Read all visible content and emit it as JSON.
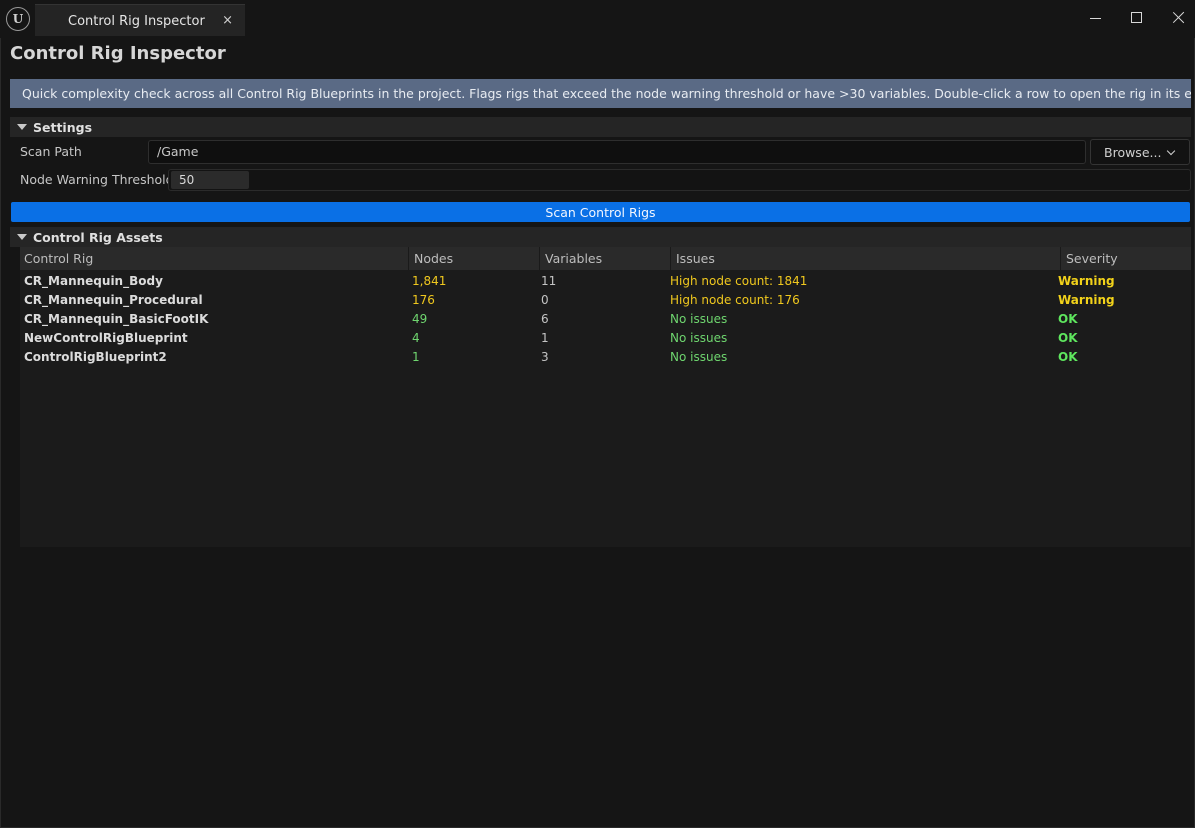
{
  "window": {
    "tab_title": "Control Rig Inspector",
    "tab_close_glyph": "×",
    "logo_text": "U"
  },
  "page": {
    "title": "Control Rig Inspector",
    "info": "Quick complexity check across all Control Rig Blueprints in the project. Flags rigs that exceed the node warning threshold or have >30 variables. Double-click a row to open the rig in its editor."
  },
  "settings": {
    "section_label": "Settings",
    "scan_path_label": "Scan Path",
    "scan_path_value": "/Game",
    "browse_label": "Browse...",
    "threshold_label": "Node Warning Threshold",
    "threshold_value": "50",
    "scan_button_label": "Scan Control Rigs"
  },
  "assets": {
    "section_label": "Control Rig Assets",
    "columns": [
      "Control Rig",
      "Nodes",
      "Variables",
      "Issues",
      "Severity"
    ],
    "rows": [
      {
        "name": "CR_Mannequin_Body",
        "nodes": "1,841",
        "variables": "11",
        "issues": "High node count: 1841",
        "severity": "Warning",
        "status": "warning"
      },
      {
        "name": "CR_Mannequin_Procedural",
        "nodes": "176",
        "variables": "0",
        "issues": "High node count: 176",
        "severity": "Warning",
        "status": "warning"
      },
      {
        "name": "CR_Mannequin_BasicFootIK",
        "nodes": "49",
        "variables": "6",
        "issues": "No issues",
        "severity": "OK",
        "status": "ok"
      },
      {
        "name": "NewControlRigBlueprint",
        "nodes": "4",
        "variables": "1",
        "issues": "No issues",
        "severity": "OK",
        "status": "ok"
      },
      {
        "name": "ControlRigBlueprint2",
        "nodes": "1",
        "variables": "3",
        "issues": "No issues",
        "severity": "OK",
        "status": "ok"
      }
    ]
  },
  "colors": {
    "warning_text": "#f0c81e",
    "warning_severity": "#f2d21a",
    "ok_text": "#6fd66f",
    "ok_severity": "#5ee65e",
    "accent": "#0a70e6",
    "banner": "#5a6a85"
  },
  "icons": {
    "logo": "unreal-logo-icon",
    "minimize": "minimize-icon",
    "maximize": "maximize-icon",
    "close": "close-icon",
    "collapse": "caret-down-icon",
    "dropdown": "chevron-down-icon"
  }
}
